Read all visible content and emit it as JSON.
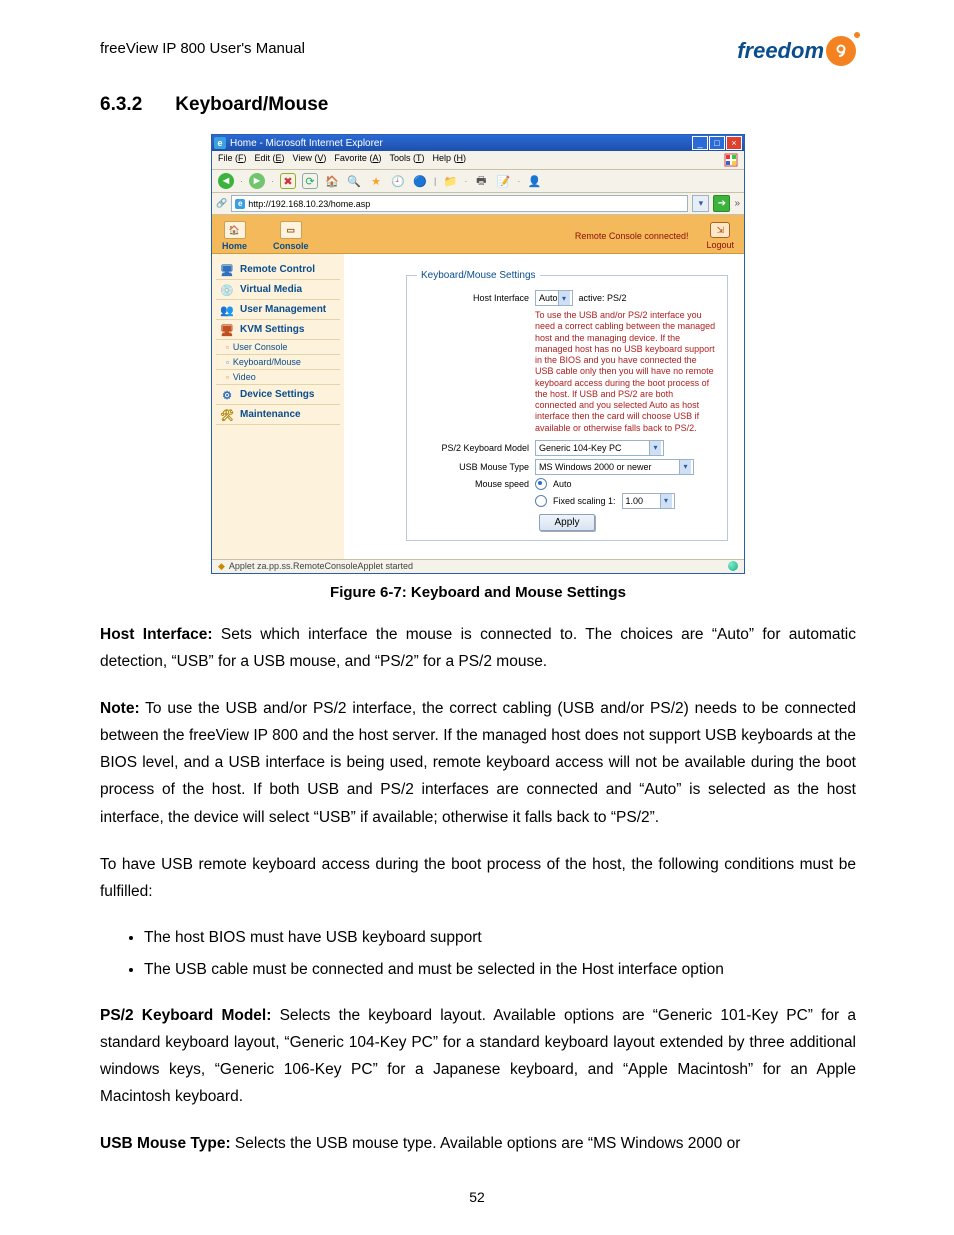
{
  "header": {
    "doc_title": "freeView IP 800 User's Manual",
    "logo_text": "freedom"
  },
  "section": {
    "number": "6.3.2",
    "title": "Keyboard/Mouse"
  },
  "browser": {
    "window_title": "Home - Microsoft Internet Explorer",
    "menu": {
      "file": "File",
      "edit": "Edit",
      "view": "View",
      "favorites": "Favorite",
      "tools": "Tools",
      "help": "Help"
    },
    "menu_acc": {
      "file": "F",
      "edit": "E",
      "view": "V",
      "favorites": "A",
      "tools": "T",
      "help": "H"
    },
    "address": "http://192.168.10.23/home.asp",
    "status_left": "Applet za.pp.ss.RemoteConsoleApplet started",
    "status_right": ""
  },
  "app": {
    "tabs": {
      "home": "Home",
      "console": "Console"
    },
    "status": "Remote Console connected!",
    "logout": "Logout",
    "sidebar": {
      "remote_control": "Remote Control",
      "virtual_media": "Virtual Media",
      "user_management": "User Management",
      "kvm_settings": "KVM Settings",
      "user_console": "User Console",
      "keyboard_mouse": "Keyboard/Mouse",
      "video": "Video",
      "device_settings": "Device Settings",
      "maintenance": "Maintenance"
    }
  },
  "form": {
    "legend": "Keyboard/Mouse Settings",
    "host_interface_label": "Host Interface",
    "host_interface_value": "Auto",
    "active_label": "active: PS/2",
    "hint": "To use the USB and/or PS/2 interface you need a correct cabling between the managed host and the managing device. If the managed host has no USB keyboard support in the BIOS and you have connected the USB cable only then you will have no remote keyboard access during the boot process of the host. If USB and PS/2 are both connected and you selected Auto as host interface then the card will choose USB if available or otherwise falls back to PS/2.",
    "ps2_model_label": "PS/2 Keyboard Model",
    "ps2_model_value": "Generic 104-Key PC",
    "usb_mouse_type_label": "USB Mouse Type",
    "usb_mouse_type_value": "MS Windows 2000 or newer",
    "mouse_speed_label": "Mouse speed",
    "mouse_speed_auto": "Auto",
    "mouse_speed_fixed": "Fixed scaling 1:",
    "mouse_speed_fixed_value": "1.00",
    "apply": "Apply"
  },
  "caption": "Figure 6-7: Keyboard and Mouse Settings",
  "para": {
    "p1_label": "Host Interface:",
    "p1_text": " Sets which interface the mouse is connected to. The choices are “Auto” for automatic detection, “USB” for a USB mouse, and “PS/2” for a PS/2 mouse.",
    "p2_label": "Note:",
    "p2_text": " To use the USB and/or PS/2 interface, the correct cabling (USB and/or PS/2) needs to be connected between the freeView IP 800 and the host server. If the managed host does not support USB keyboards at the BIOS level, and a USB interface is being used, remote keyboard access will not be available during the boot process of the host. If both USB and PS/2 interfaces are connected and “Auto” is selected as the host interface, the device will select “USB” if available; otherwise it falls back to “PS/2”.",
    "p3_text": "To have USB remote keyboard access during the boot process of the host, the following conditions must be fulfilled:",
    "b1": "The host BIOS must have USB keyboard support",
    "b2": "The USB cable must be connected and must be selected in the Host interface option",
    "p4_label": "PS/2 Keyboard Model:",
    "p4_text": " Selects the keyboard layout. Available options are “Generic 101-Key PC” for a standard keyboard layout, “Generic 104-Key PC” for a standard keyboard layout extended by three additional windows keys, “Generic 106-Key PC” for a Japanese keyboard, and “Apple Macintosh” for an Apple Macintosh keyboard.",
    "p5_label": "USB Mouse Type:",
    "p5_text": " Selects the USB mouse type. Available options are “MS Windows 2000 or"
  },
  "page_number": "52"
}
